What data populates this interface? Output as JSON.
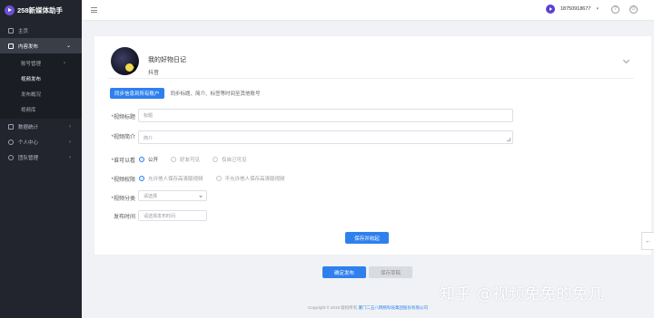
{
  "app": {
    "title": "258新媒体助手"
  },
  "sidebar": {
    "items": [
      {
        "label": "主页",
        "icon": "home-icon"
      },
      {
        "label": "内容发布",
        "icon": "publish-icon",
        "active": true
      },
      {
        "label": "数据统计",
        "icon": "stats-icon"
      },
      {
        "label": "个人中心",
        "icon": "user-icon"
      },
      {
        "label": "团队管理",
        "icon": "team-icon"
      }
    ],
    "sub_items": [
      {
        "label": "账号管理"
      },
      {
        "label": "视频发布",
        "active": true
      },
      {
        "label": "发布概况"
      },
      {
        "label": "视频库"
      }
    ]
  },
  "header": {
    "phone": "18750918677",
    "help_icon": "?",
    "power_icon": "⏻"
  },
  "account": {
    "name": "我的好物日记",
    "platform": "抖音"
  },
  "sync": {
    "button": "同步信息到所有账户",
    "description": "同步标题、简介、标签等时间至其他账号"
  },
  "form": {
    "title_label": "*视频标题",
    "title_placeholder": "标题",
    "intro_label": "*视频简介",
    "intro_placeholder": "简介",
    "visibility_label": "*谁可以看",
    "visibility_options": [
      "公开",
      "好友可见",
      "仅自己可见"
    ],
    "permission_label": "*视频权限",
    "permission_options": [
      "允许他人保存高清版视频",
      "不允许他人保存高清版视频"
    ],
    "category_label": "*视频分类",
    "category_placeholder": "请选择",
    "time_label": "发布时间",
    "time_placeholder": "请选择发布时间",
    "save_button": "保存并收起"
  },
  "actions": {
    "publish": "确定发布",
    "draft": "保存草稿"
  },
  "footer": {
    "copyright": "Copyright © 2019 版权所有",
    "company": "厦门二五八网络科技集团股份有限公司"
  },
  "watermark": "知乎 @视频免免的免几"
}
